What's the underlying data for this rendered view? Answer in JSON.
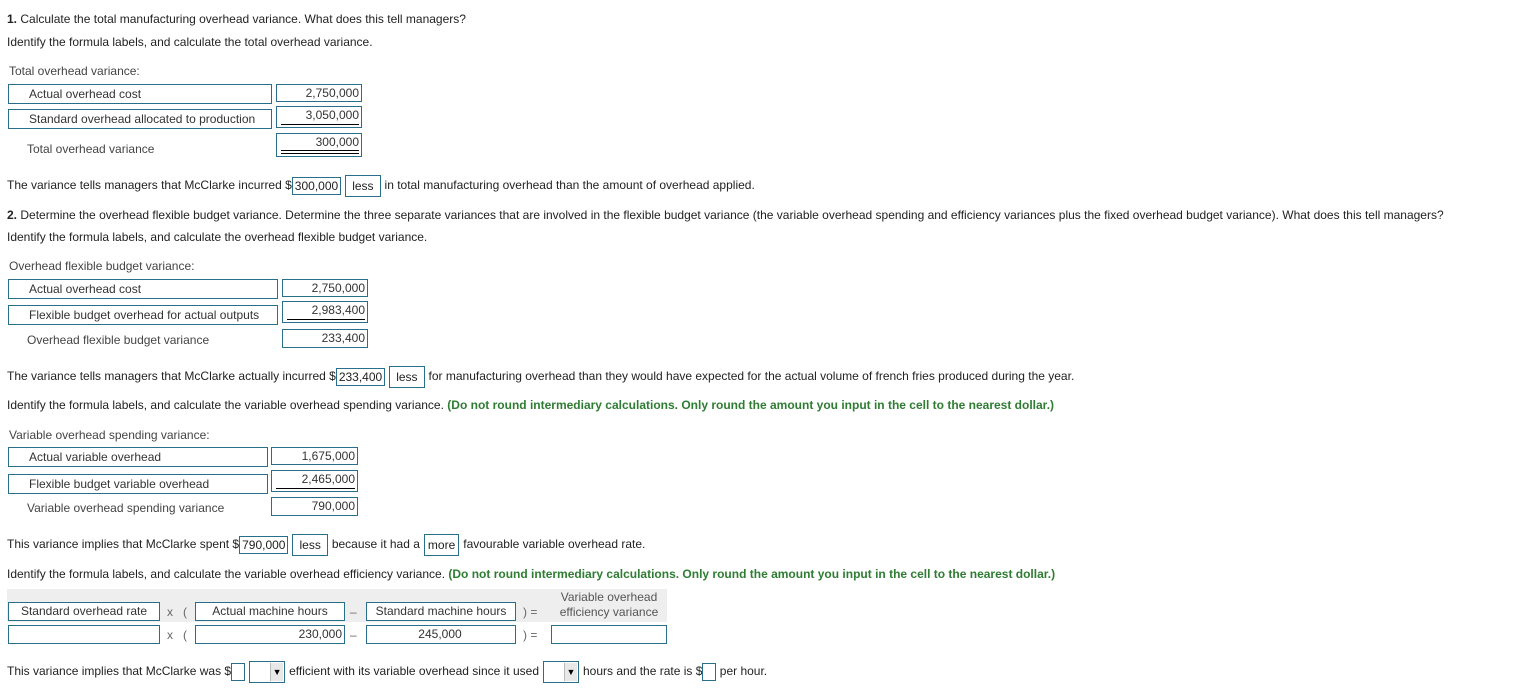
{
  "q1": {
    "number": "1.",
    "title": "Calculate the total manufacturing overhead variance. What does this tell managers?",
    "instruction": "Identify the formula labels, and calculate the total overhead variance.",
    "table_title": "Total overhead variance:",
    "rows": [
      {
        "label": "Actual overhead cost",
        "value": "2,750,000"
      },
      {
        "label": "Standard overhead allocated to production",
        "value": "3,050,000"
      }
    ],
    "result_label": "Total overhead variance",
    "result_value": "300,000",
    "sentence": {
      "pre": "The variance tells managers that McClarke incurred $",
      "amount": "300,000",
      "select": "less",
      "post": "in total manufacturing overhead than the amount of overhead applied."
    }
  },
  "q2": {
    "number": "2.",
    "title": "Determine the overhead flexible budget variance. Determine the three separate variances that are involved in the flexible budget variance (the variable overhead spending and efficiency variances plus the fixed overhead budget variance). What does this tell managers?",
    "instruction": "Identify the formula labels, and calculate the overhead flexible budget variance.",
    "table_title": "Overhead flexible budget variance:",
    "rows": [
      {
        "label": "Actual overhead cost",
        "value": "2,750,000"
      },
      {
        "label": "Flexible budget overhead for actual outputs",
        "value": "2,983,400"
      }
    ],
    "result_label": "Overhead flexible budget variance",
    "result_value": "233,400",
    "sentence": {
      "pre": "The variance tells managers that McClarke actually incurred $",
      "amount": "233,400",
      "select": "less",
      "post": "for manufacturing overhead than they would have expected for the actual volume of french fries produced during the year."
    }
  },
  "spending": {
    "instruction": "Identify the formula labels, and calculate the variable overhead spending variance.",
    "note": "(Do not round intermediary calculations. Only round the amount you input in the cell to the nearest dollar.)",
    "table_title": "Variable overhead spending variance:",
    "rows": [
      {
        "label": "Actual variable overhead",
        "value": "1,675,000"
      },
      {
        "label": "Flexible budget variable overhead",
        "value": "2,465,000"
      }
    ],
    "result_label": "Variable overhead spending variance",
    "result_value": "790,000",
    "sentence": {
      "pre": "This variance implies that McClarke spent $",
      "amount": "790,000",
      "select1": "less",
      "mid": "because it had a",
      "select2": "more",
      "post": "favourable variable overhead rate."
    }
  },
  "efficiency": {
    "instruction": "Identify the formula labels, and calculate the variable overhead efficiency variance.",
    "note": "(Do not round intermediary calculations. Only round the amount you input in the cell to the nearest dollar.)",
    "headers": {
      "rate": "Standard overhead rate",
      "actual_hours": "Actual machine hours",
      "standard_hours": "Standard machine hours",
      "result_line1": "Variable overhead",
      "result_line2": "efficiency variance"
    },
    "operators": {
      "times": "x",
      "open": "(",
      "minus": "–",
      "close_eq": ") ="
    },
    "values": {
      "rate": "",
      "actual_hours": "230,000",
      "standard_hours": "245,000",
      "result": ""
    },
    "sentence": {
      "pre": "This variance implies that McClarke was $",
      "amount": "",
      "select1": "",
      "mid": "efficient with its variable overhead since it used",
      "select2": "",
      "mid2": "hours and the rate is $",
      "rate": "",
      "post": "per hour."
    }
  }
}
